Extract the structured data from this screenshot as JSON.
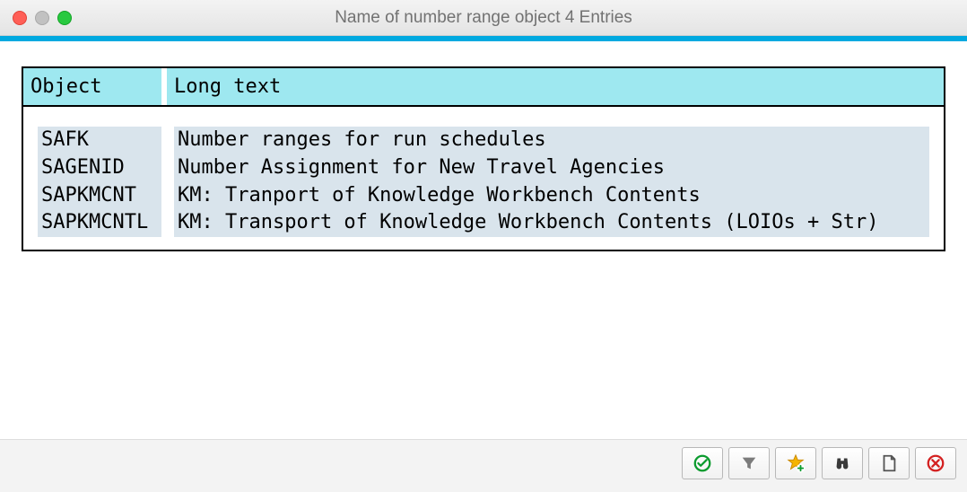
{
  "window": {
    "title": "Name of number range object 4 Entries"
  },
  "columns": {
    "object": "Object",
    "long": "Long text"
  },
  "rows": [
    {
      "object": "SAFK",
      "long": "Number ranges for run schedules",
      "selected": true
    },
    {
      "object": "SAGENID",
      "long": "Number Assignment for New Travel Agencies",
      "selected": false
    },
    {
      "object": "SAPKMCNT",
      "long": "KM: Tranport of Knowledge Workbench Contents",
      "selected": false
    },
    {
      "object": "SAPKMCNTL",
      "long": "KM: Transport of Knowledge Workbench Contents (LOIOs + Str)",
      "selected": false
    }
  ],
  "toolbar": {
    "accept": "Accept",
    "filter": "Filter",
    "favorite": "Add favorite",
    "find": "Find",
    "new": "New",
    "cancel": "Cancel"
  }
}
